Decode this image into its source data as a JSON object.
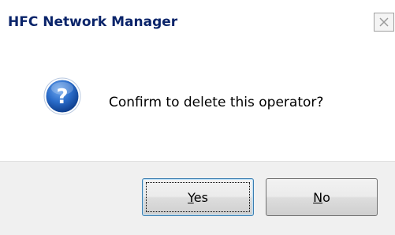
{
  "window": {
    "title": "HFC Network Manager",
    "close_icon": "close-icon"
  },
  "dialog": {
    "icon": "question-icon",
    "message": "Confirm to delete this operator?"
  },
  "buttons": {
    "yes": {
      "mnemonic": "Y",
      "rest": "es"
    },
    "no": {
      "mnemonic": "N",
      "rest": "o"
    }
  },
  "colors": {
    "title": "#0a246a",
    "icon_blue": "#1f5fb6",
    "footer_bg": "#f0f0f0"
  }
}
